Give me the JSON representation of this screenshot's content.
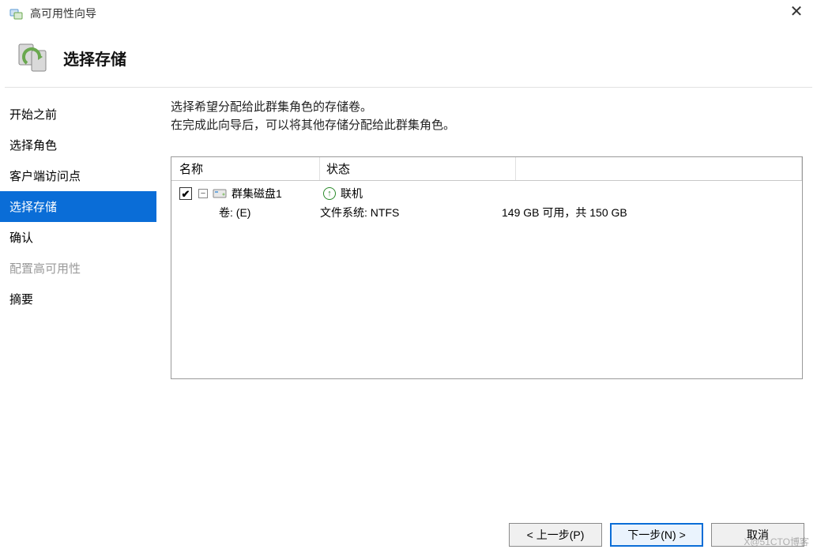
{
  "window": {
    "title": "高可用性向导",
    "close_glyph": "✕"
  },
  "header": {
    "title": "选择存储"
  },
  "sidebar": {
    "items": [
      {
        "label": "开始之前",
        "state": "normal"
      },
      {
        "label": "选择角色",
        "state": "normal"
      },
      {
        "label": "客户端访问点",
        "state": "normal"
      },
      {
        "label": "选择存储",
        "state": "active"
      },
      {
        "label": "确认",
        "state": "normal"
      },
      {
        "label": "配置高可用性",
        "state": "disabled"
      },
      {
        "label": "摘要",
        "state": "normal"
      }
    ]
  },
  "main": {
    "instruction_line1": "选择希望分配给此群集角色的存储卷。",
    "instruction_line2": "在完成此向导后，可以将其他存储分配给此群集角色。",
    "table": {
      "headers": {
        "name": "名称",
        "status": "状态"
      },
      "row": {
        "checked": true,
        "expanded": true,
        "disk_name": "群集磁盘1",
        "status_text": "联机",
        "volume_label": "卷: (E)",
        "fs_label": "文件系统: NTFS",
        "size_text": "149 GB 可用，共 150 GB"
      }
    }
  },
  "footer": {
    "back": "< 上一步(P)",
    "next": "下一步(N) >",
    "cancel": "取消"
  },
  "glyphs": {
    "check": "✔",
    "minus": "−",
    "up_arrow": "↑"
  },
  "watermark": "X@51CTO博客"
}
